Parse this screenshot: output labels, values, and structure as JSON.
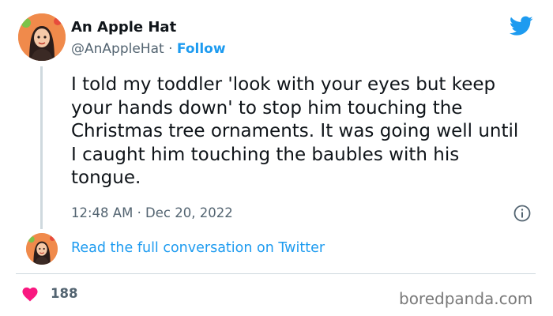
{
  "tweet": {
    "display_name": "An Apple Hat",
    "handle": "@AnAppleHat",
    "separator": "·",
    "follow_label": "Follow",
    "text": "I told my toddler 'look with your eyes but keep your hands down' to stop him touching the Christmas tree ornaments. It was going well until I caught him touching the baubles with his tongue.",
    "timestamp": "12:48 AM · Dec 20, 2022",
    "read_link": "Read the full conversation on Twitter",
    "like_count": "188"
  },
  "watermark": "boredpanda.com",
  "icons": {
    "brand": "twitter-bird-icon",
    "info": "info-icon",
    "like": "heart-icon"
  },
  "colors": {
    "link": "#1d9bf0",
    "text": "#0f1419",
    "secondary": "#536471",
    "heart": "#f91880",
    "avatar_bg": "#f08a4b"
  }
}
